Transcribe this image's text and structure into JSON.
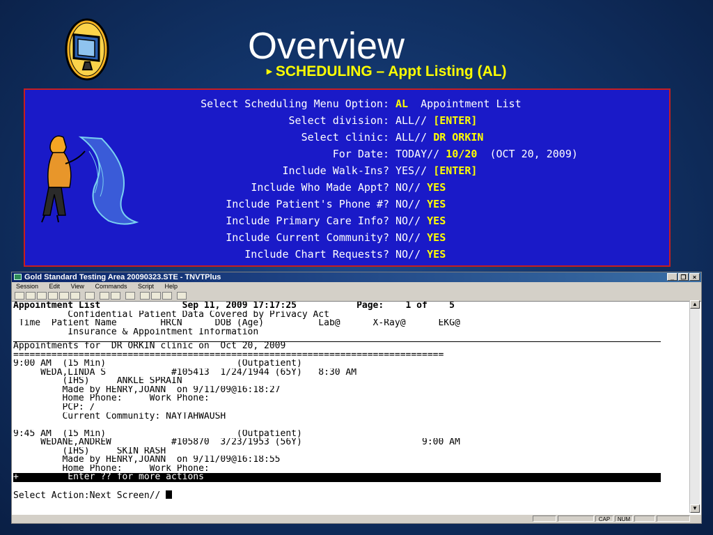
{
  "slide": {
    "title": "Overview",
    "subtitle": "SCHEDULING – Appt Listing (AL)"
  },
  "prompts": [
    {
      "label": "Select Scheduling Menu Option:",
      "value": "",
      "entry": "AL",
      "suffix": "  Appointment List"
    },
    {
      "label": "Select division:",
      "value": "ALL// ",
      "entry": "[ENTER]",
      "suffix": ""
    },
    {
      "label": "Select clinic:",
      "value": "ALL// ",
      "entry": "DR ORKIN",
      "suffix": ""
    },
    {
      "label": "For Date:",
      "value": "TODAY// ",
      "entry": "10/20",
      "suffix": "  (OCT 20, 2009)"
    },
    {
      "label": "Include Walk-Ins?",
      "value": "YES// ",
      "entry": "[ENTER]",
      "suffix": ""
    },
    {
      "label": "Include Who Made Appt?",
      "value": "NO// ",
      "entry": "YES",
      "suffix": ""
    },
    {
      "label": "Include Patient's Phone #?",
      "value": "NO// ",
      "entry": "YES",
      "suffix": ""
    },
    {
      "label": "Include Primary Care Info?",
      "value": "NO// ",
      "entry": "YES",
      "suffix": ""
    },
    {
      "label": "Include Current Community?",
      "value": "NO// ",
      "entry": "YES",
      "suffix": ""
    },
    {
      "label": "Include Chart Requests?",
      "value": "NO// ",
      "entry": "YES",
      "suffix": ""
    }
  ],
  "window": {
    "title": "Gold Standard Testing Area 20090323.STE - TNVTPlus",
    "menu": [
      "Session",
      "Edit",
      "View",
      "Commands",
      "Script",
      "Help"
    ],
    "buttons": {
      "minimize": "_",
      "restore": "❐",
      "close": "×"
    }
  },
  "terminal": {
    "lines": [
      {
        "text": "Appointment List               Sep 11, 2009 17:17:25           Page:    1 of    5",
        "style": "bold"
      },
      {
        "text": "          Confidential Patient Data Covered by Privacy Act",
        "style": ""
      },
      {
        "text": " Time  Patient Name        HRCN      DOB (Age)          Lab@      X-Ray@      EKG@",
        "style": ""
      },
      {
        "text": "          Insurance & Appointment Information",
        "style": ""
      },
      {
        "text": "",
        "style": "hr"
      },
      {
        "text": "Appointments for  DR ORKIN clinic on  Oct 20, 2009",
        "style": ""
      },
      {
        "text": "===============================================================================",
        "style": ""
      },
      {
        "text": "9:00 AM  (15 Min)                        (Outpatient)",
        "style": ""
      },
      {
        "text": "     WEDA,LINDA S            #105413  1/24/1944 (65Y)   8:30 AM",
        "style": ""
      },
      {
        "text": "         (IHS)     ANKLE SPRAIN",
        "style": ""
      },
      {
        "text": "         Made by HENRY,JOANN  on 9/11/09@16:18:27",
        "style": ""
      },
      {
        "text": "         Home Phone:     Work Phone:",
        "style": ""
      },
      {
        "text": "         PCP: /",
        "style": ""
      },
      {
        "text": "         Current Community: NAYTAHWAUSH",
        "style": ""
      },
      {
        "text": "",
        "style": ""
      },
      {
        "text": "9:45 AM  (15 Min)                        (Outpatient)",
        "style": ""
      },
      {
        "text": "     WEDANE,ANDREW           #105870  3/23/1953 (56Y)                      9:00 AM",
        "style": ""
      },
      {
        "text": "         (IHS)     SKIN RASH",
        "style": ""
      },
      {
        "text": "         Made by HENRY,JOANN  on 9/11/09@16:18:55",
        "style": ""
      },
      {
        "text": "         Home Phone:     Work Phone:",
        "style": ""
      },
      {
        "text": "+         Enter ?? for more actions                                            ",
        "style": "rev"
      },
      {
        "text": "",
        "style": ""
      },
      {
        "text": "Select Action:Next Screen// ",
        "style": "cursor"
      }
    ]
  },
  "status": [
    "CAP",
    "NUM"
  ],
  "colors": {
    "accent_yellow": "#ffff00",
    "prompt_bg": "#1a1ac8",
    "prompt_border": "#c81e1e"
  }
}
